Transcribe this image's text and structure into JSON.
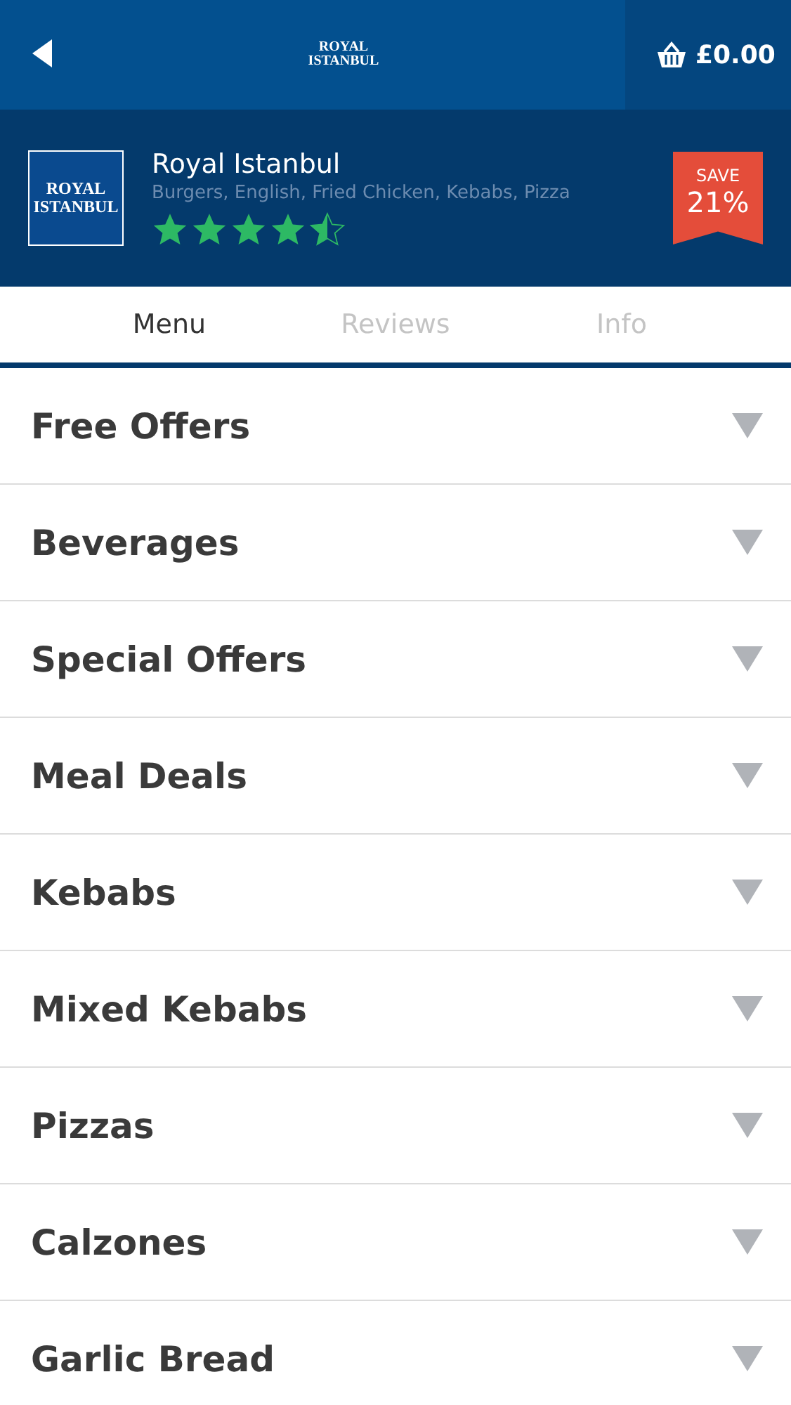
{
  "top_bar": {
    "logo": [
      "ROYAL",
      "ISTANBUL"
    ],
    "basket_total": "£0.00"
  },
  "restaurant": {
    "logo": [
      "ROYAL",
      "ISTANBUL"
    ],
    "name": "Royal Istanbul",
    "cuisines": "Burgers, English, Fried Chicken, Kebabs, Pizza",
    "stars": 4.5,
    "badge": {
      "label": "SAVE",
      "value": "21%"
    }
  },
  "tabs": [
    {
      "label": "Menu",
      "selected": true
    },
    {
      "label": "Reviews",
      "selected": false
    },
    {
      "label": "Info",
      "selected": false
    }
  ],
  "categories": [
    {
      "name": "Free Offers",
      "expanded": false
    },
    {
      "name": "Beverages",
      "expanded": false
    },
    {
      "name": "Special Offers",
      "expanded": false
    },
    {
      "name": "Meal Deals",
      "expanded": false
    },
    {
      "name": "Kebabs",
      "expanded": false
    },
    {
      "name": "Mixed Kebabs",
      "expanded": false
    },
    {
      "name": "Pizzas",
      "expanded": false
    },
    {
      "name": "Calzones",
      "expanded": false
    },
    {
      "name": "Garlic Bread",
      "expanded": false
    }
  ]
}
